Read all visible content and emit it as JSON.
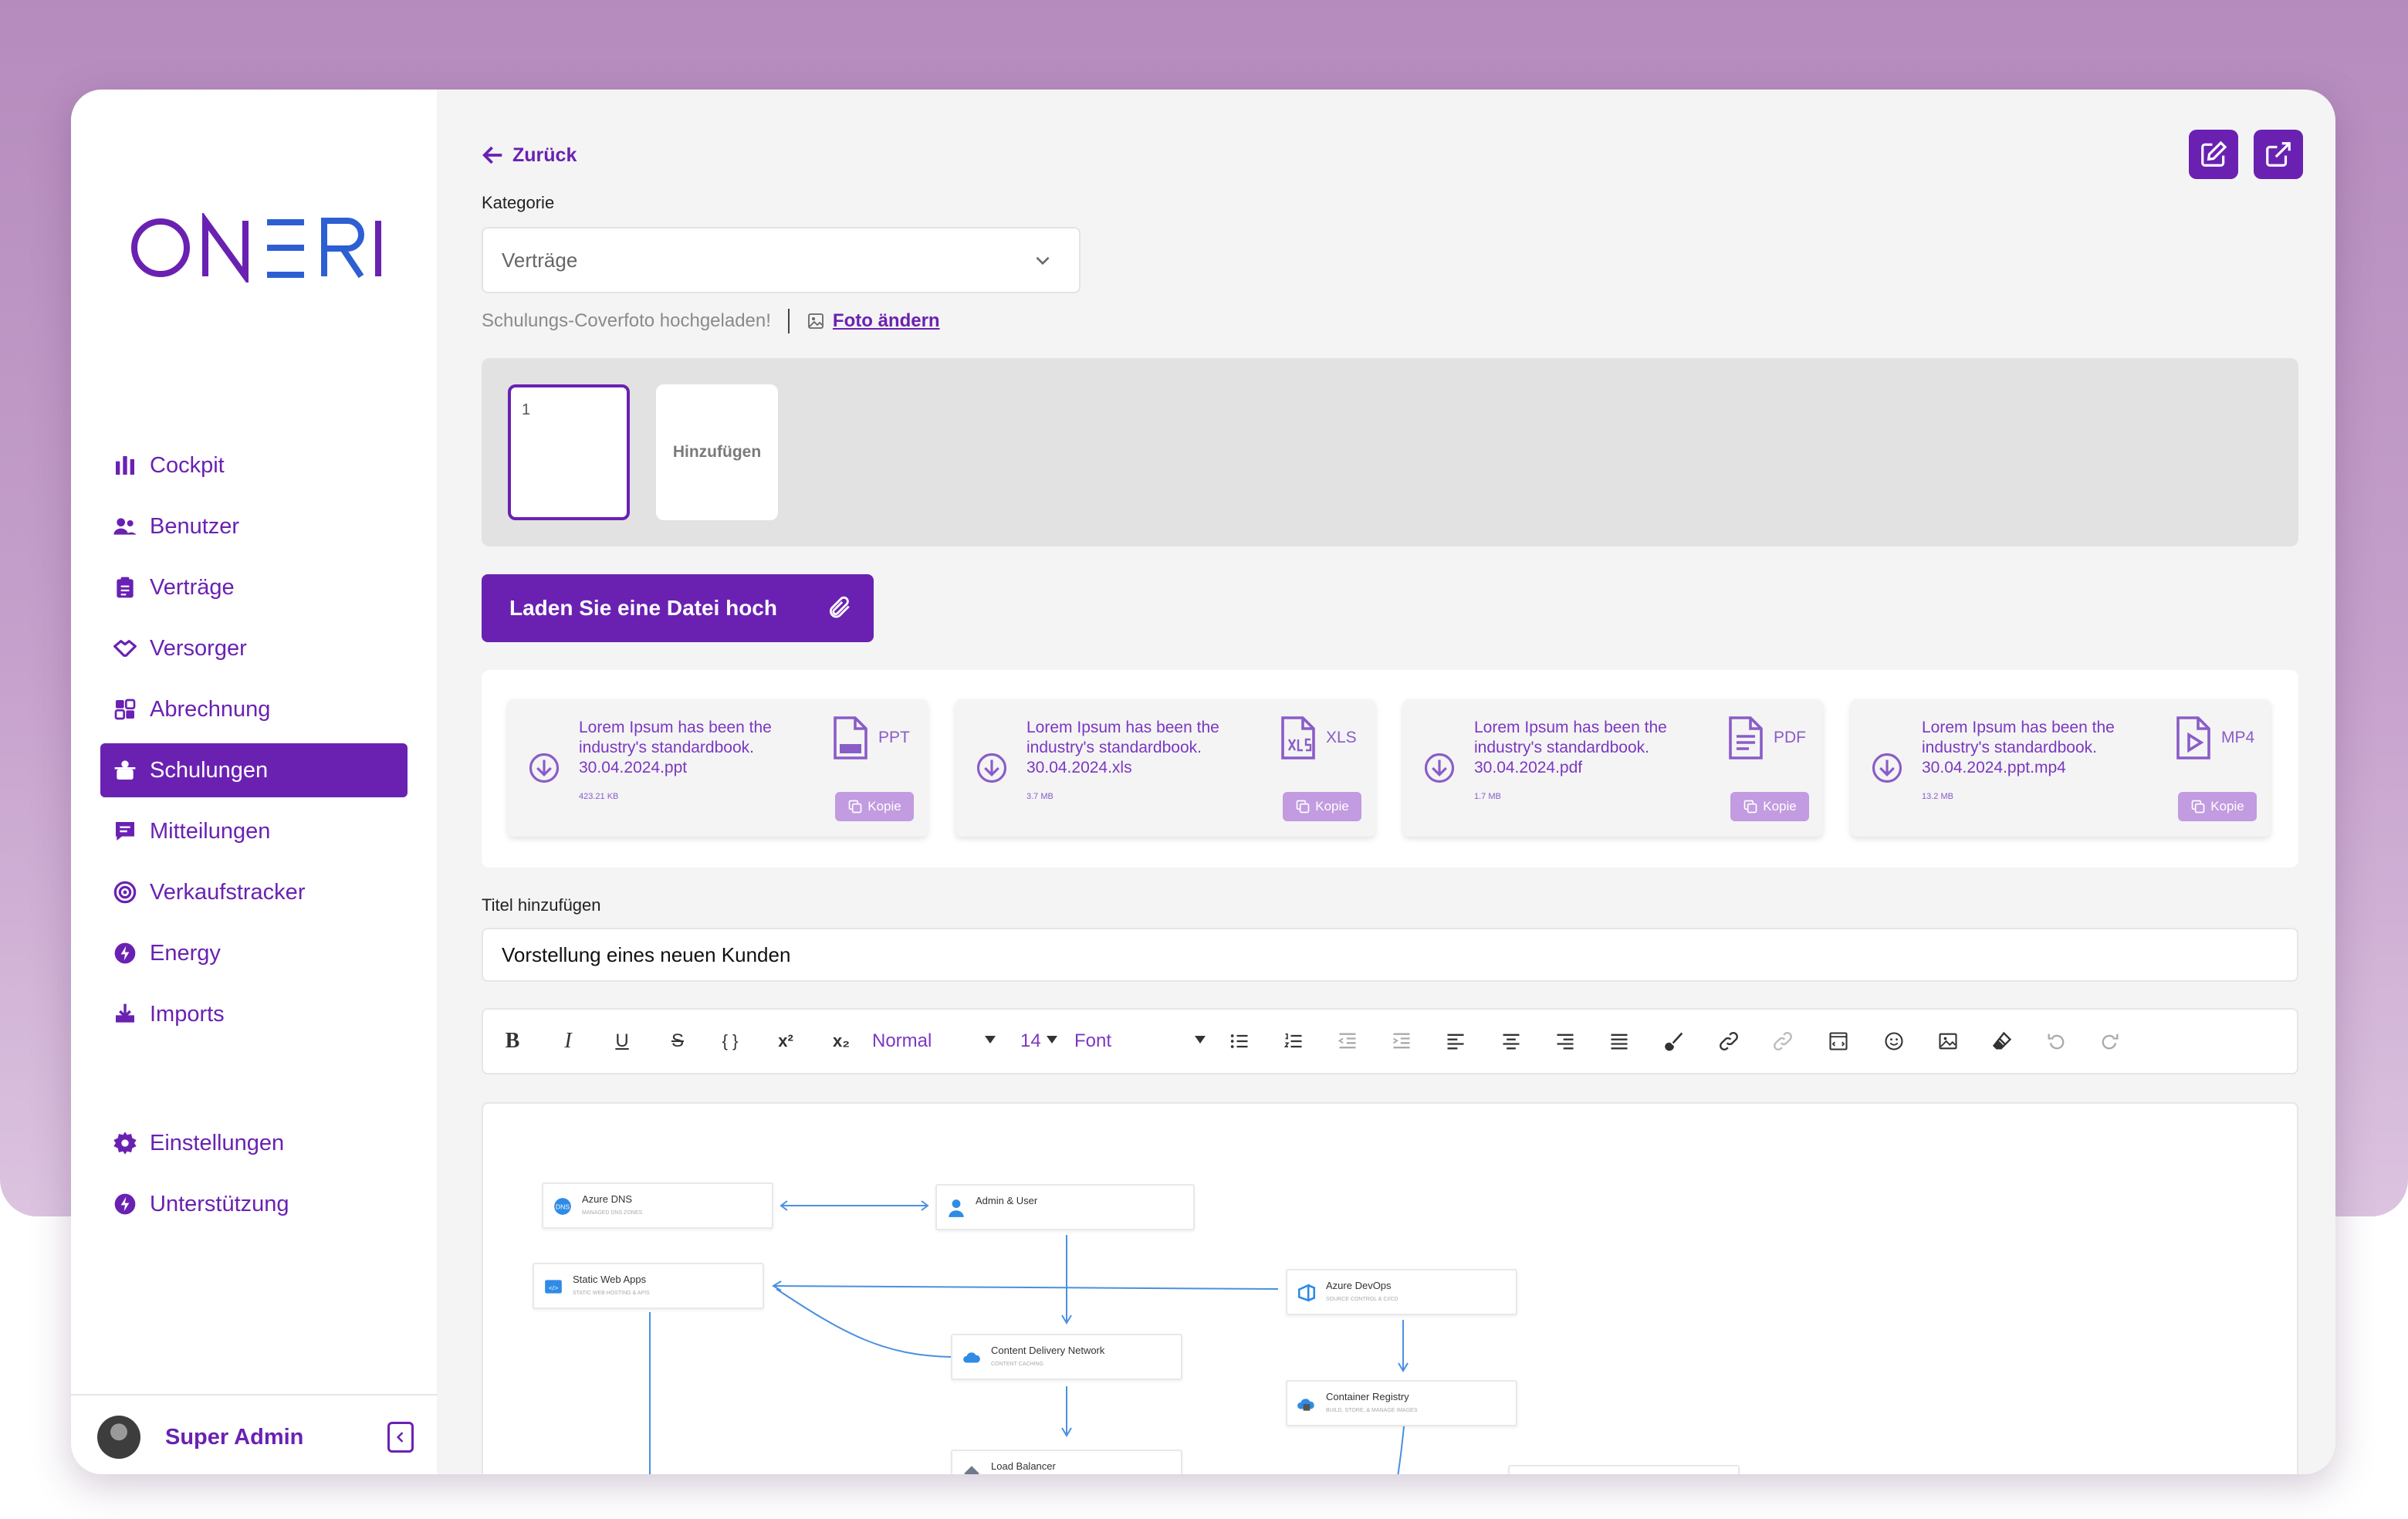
{
  "brand": {
    "logo_text": "ON=RI"
  },
  "nav": {
    "items": [
      {
        "label": "Cockpit",
        "icon": "chart-bars-icon"
      },
      {
        "label": "Benutzer",
        "icon": "users-icon"
      },
      {
        "label": "Verträge",
        "icon": "clipboard-icon"
      },
      {
        "label": "Versorger",
        "icon": "handshake-icon"
      },
      {
        "label": "Abrechnung",
        "icon": "dashboard-icon"
      },
      {
        "label": "Schulungen",
        "icon": "training-icon",
        "active": true
      },
      {
        "label": "Mitteilungen",
        "icon": "message-icon"
      },
      {
        "label": "Verkaufstracker",
        "icon": "target-icon"
      },
      {
        "label": "Energy",
        "icon": "bolt-icon"
      },
      {
        "label": "Imports",
        "icon": "import-icon"
      }
    ],
    "bottom_items": [
      {
        "label": "Einstellungen",
        "icon": "gear-icon"
      },
      {
        "label": "Unterstützung",
        "icon": "bolt-icon"
      }
    ]
  },
  "user": {
    "name": "Super Admin"
  },
  "header": {
    "back_label": "Zurück"
  },
  "category": {
    "label": "Kategorie",
    "value": "Verträge"
  },
  "cover": {
    "status": "Schulungs-Coverfoto hochgeladen!",
    "change_label": "Foto ändern"
  },
  "slides": {
    "first_number": "1",
    "add_label": "Hinzufügen"
  },
  "upload": {
    "label": "Laden Sie eine Datei hoch"
  },
  "files": [
    {
      "line1": "Lorem Ipsum has been the",
      "line2": "industry's standardbook.",
      "filename": "30.04.2024.ppt",
      "size": "423.21 KB",
      "type": "PPT",
      "copy_label": "Kopie"
    },
    {
      "line1": "Lorem Ipsum has been the",
      "line2": "industry's standardbook.",
      "filename": "30.04.2024.xls",
      "size": "3.7 MB",
      "type": "XLS",
      "copy_label": "Kopie"
    },
    {
      "line1": "Lorem Ipsum has been the",
      "line2": "industry's standardbook.",
      "filename": "30.04.2024.pdf",
      "size": "1.7 MB",
      "type": "PDF",
      "copy_label": "Kopie"
    },
    {
      "line1": "Lorem Ipsum has been the",
      "line2": "industry's standardbook.",
      "filename": "30.04.2024.ppt.mp4",
      "size": "13.2 MB",
      "type": "MP4",
      "copy_label": "Kopie"
    }
  ],
  "title_field": {
    "label": "Titel hinzufügen",
    "value": "Vorstellung eines neuen Kunden"
  },
  "toolbar": {
    "paragraph_style": "Normal",
    "font_size": "14",
    "font": "Font"
  },
  "diagram": {
    "nodes": [
      {
        "title": "Azure DNS",
        "subtitle": "MANAGED DNS ZONES"
      },
      {
        "title": "Admin & User",
        "subtitle": ""
      },
      {
        "title": "Static Web Apps",
        "subtitle": "STATIC WEB HOSTING & APIS"
      },
      {
        "title": "Azure DevOps",
        "subtitle": "SOURCE CONTROL & CI/CD"
      },
      {
        "title": "Content Delivery Network",
        "subtitle": "CONTENT CACHING"
      },
      {
        "title": "Container Registry",
        "subtitle": "BUILD, STORE, & MANAGE IMAGES"
      },
      {
        "title": "Load Balancer",
        "subtitle": ""
      }
    ]
  },
  "colors": {
    "accent": "#6a21b2",
    "background": "#f4f4f4",
    "diagram_line": "#4a90e2"
  }
}
